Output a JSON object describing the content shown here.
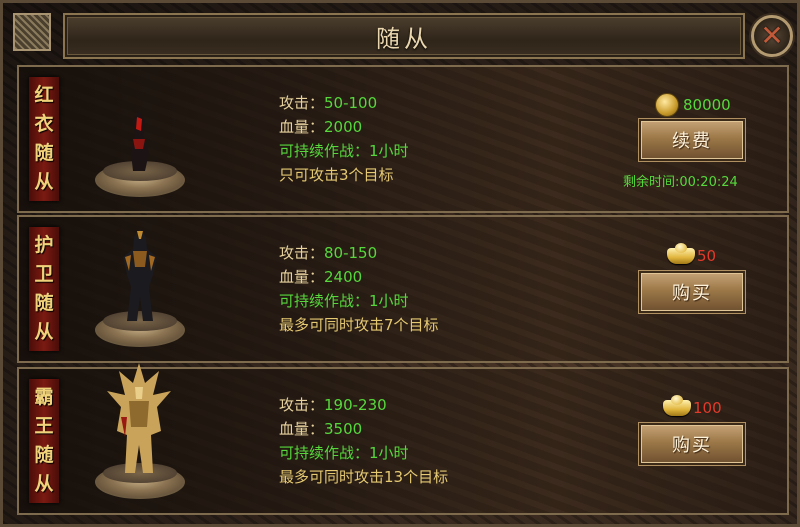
{
  "window": {
    "title": "随从"
  },
  "close_button": {
    "label": "✕"
  },
  "followers": [
    {
      "banner": [
        "红",
        "衣",
        "随",
        "从"
      ],
      "attack_label": "攻击：",
      "attack_value": "50-100",
      "hp_label": "血量：",
      "hp_value": "2000",
      "duration": "可持续作战：1小时",
      "targets": "只可攻击3个目标",
      "price": "80000",
      "price_currency": "coin",
      "button": "续费",
      "remaining": "剩余时间:00:20:24"
    },
    {
      "banner": [
        "护",
        "卫",
        "随",
        "从"
      ],
      "attack_label": "攻击：",
      "attack_value": "80-150",
      "hp_label": "血量：",
      "hp_value": "2400",
      "duration": "可持续作战：1小时",
      "targets": "最多可同时攻击7个目标",
      "price": "50",
      "price_currency": "gold-ingot",
      "button": "购买"
    },
    {
      "banner": [
        "霸",
        "王",
        "随",
        "从"
      ],
      "attack_label": "攻击：",
      "attack_value": "190-230",
      "hp_label": "血量：",
      "hp_value": "3500",
      "duration": "可持续作战：1小时",
      "targets": "最多可同时攻击13个目标",
      "price": "100",
      "price_currency": "gold-ingot",
      "button": "购买"
    }
  ]
}
